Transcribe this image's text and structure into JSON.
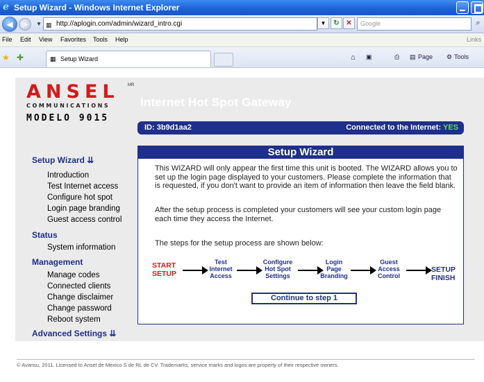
{
  "window": {
    "title": "Setup Wizard - Windows Internet Explorer"
  },
  "addressbar": {
    "url": "http://aplogin.com/admin/wizard_intro.cgi",
    "search_placeholder": "Google"
  },
  "menubar": {
    "items": [
      "File",
      "Edit",
      "View",
      "Favorites",
      "Tools",
      "Help"
    ],
    "links": "Links"
  },
  "tabbar": {
    "tab_title": "Setup Wizard",
    "page_label": "Page",
    "tools_label": "Tools"
  },
  "logo": {
    "brand": "ANSEL",
    "mark": "MR",
    "subtitle": "COMMUNICATIONS",
    "model": "MODELO 9015"
  },
  "header": {
    "title": "Internet Hot Spot Gateway",
    "id_label": "ID: 3b9d1aa2",
    "connected_label": "Connected to the Internet:",
    "connected_value": "YES"
  },
  "sidebar": {
    "setup_wizard": "Setup Wizard ⇊",
    "setup_items": [
      "Introduction",
      "Test Internet access",
      "Configure hot spot",
      "Login page branding",
      "Guest access control"
    ],
    "status": "Status",
    "status_items": [
      "System information"
    ],
    "management": "Management",
    "management_items": [
      "Manage codes",
      "Connected clients",
      "Change disclaimer",
      "Change password",
      "Reboot system"
    ],
    "advanced": "Advanced Settings ⇊"
  },
  "wizard": {
    "title": "Setup Wizard",
    "p1": "This WIZARD will only appear the first time this unit is booted. The WIZARD allows you to set up the login page displayed to your customers. Please complete the information that is requested, if you don't want to provide an item of information then leave the field blank.",
    "p2": "After the setup process is completed your customers will see your custom login page each time they access the Internet.",
    "p3": "The steps for the setup process are shown below:",
    "steps": {
      "start": "START\nSETUP",
      "s1": "Test\nInternet\nAccess",
      "s2": "Configure\nHot Spot\nSettings",
      "s3": "Login\nPage\nBranding",
      "s4": "Guest\nAccess\nControl",
      "finish": "SETUP\nFINISH"
    },
    "continue_label": "Continue to step 1"
  },
  "footer": "© Avansu, 2011. Licensed to Ansel de Mexico S de RL de CV. Trademarks, service marks and logos are property of their respective owners.",
  "colors": {
    "navy": "#1f2f8c",
    "red": "#d21a1a",
    "green": "#5de05d",
    "panel_gray": "#ebebeb"
  }
}
